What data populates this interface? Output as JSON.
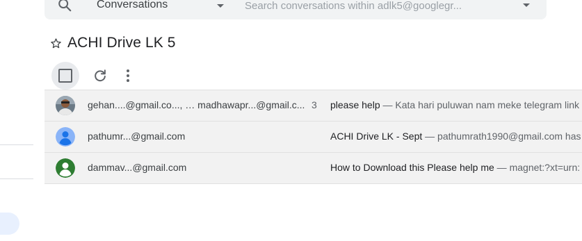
{
  "search": {
    "scope": "Conversations",
    "placeholder": "Search conversations within adlk5@googlegr..."
  },
  "group": {
    "title": "ACHI Drive LK 5"
  },
  "icons": {
    "search": "search-icon",
    "star": "star-outline-icon",
    "refresh": "refresh-icon",
    "more": "more-vertical-icon"
  },
  "conversations": [
    {
      "sender": "gehan....@gmail.co..., … madhawapr...@gmail.c...",
      "count": "3",
      "subject": "please help",
      "separator": " — ",
      "snippet": "Kata hari puluwan nam meke telegram link"
    },
    {
      "sender": "pathumr...@gmail.com",
      "count": "",
      "subject": "ACHI Drive LK - Sept",
      "separator": " — ",
      "snippet": "pathumrath1990@gmail.com has"
    },
    {
      "sender": "dammav...@gmail.com",
      "count": "",
      "subject": "How to Download this Please help me",
      "separator": " — ",
      "snippet": "magnet:?xt=urn:"
    }
  ],
  "colors": {
    "row_bg": "#f2f2f2",
    "search_bg": "#f1f3f4",
    "avatar_blue": "#8ab4f8",
    "avatar_green": "#2e7d32"
  }
}
